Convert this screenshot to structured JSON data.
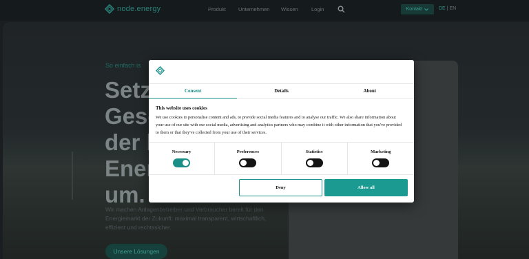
{
  "header": {
    "logo_text": "node.energy",
    "nav": [
      "Produkt",
      "Unternehmen",
      "Wissen",
      "Login"
    ],
    "contact_label": "Kontakt",
    "lang_active": "DE",
    "lang_sep": " | ",
    "lang_other": "EN"
  },
  "hero": {
    "eyebrow": "So einfach is",
    "headline_lines": [
      "Setze",
      "Gesch",
      "der k",
      "Energ",
      "um."
    ],
    "subtext": "Wir machen Anlagenbetreiber und Verbraucher bereit für den Energiemarkt der Zukunft: maximal transparent, wirtschaftlich, effizient und rechtssicher.",
    "cta": "Unsere Lösungen"
  },
  "cookie_dialog": {
    "tabs": [
      "Consent",
      "Details",
      "About"
    ],
    "heading": "This website uses cookies",
    "body": "We use cookies to personalise content and ads, to provide social media features and to analyse our traffic. We also share information about your use of our site with our social media, advertising and analytics partners who may combine it with other information that you've provided to them or that they've collected from your use of their services.",
    "toggles": [
      {
        "label": "Necessary",
        "on": true
      },
      {
        "label": "Preferences",
        "on": false
      },
      {
        "label": "Statistics",
        "on": false
      },
      {
        "label": "Marketing",
        "on": false
      }
    ],
    "deny_label": "Deny",
    "allow_label": "Allow all"
  },
  "colors": {
    "accent": "#1a8f87",
    "nav_bg": "#151a1c",
    "hero_bg": "#23292b"
  }
}
